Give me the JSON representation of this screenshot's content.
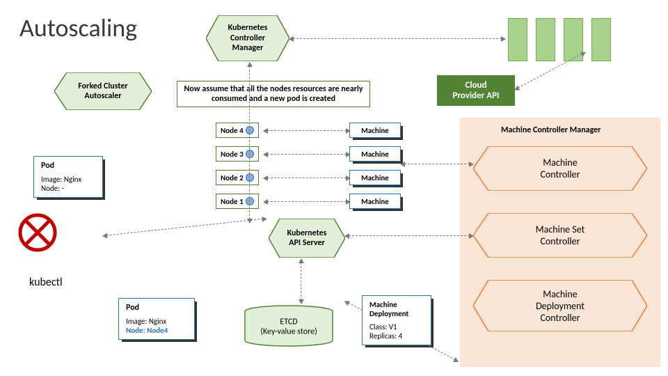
{
  "title": "Autoscaling",
  "k8s_controller_manager": "Kubernetes\nController\nManager",
  "forked_autoscaler": "Forked Cluster\nAutoscaler",
  "note": "Now assume that all the nodes resources are nearly consumed and a new pod is created",
  "nodes": [
    "Node 4",
    "Node 3",
    "Node 2",
    "Node 1"
  ],
  "machine_label": "Machine",
  "cloud_api": "Cloud\nProvider API",
  "mcm_label": "Machine Controller Manager",
  "controllers": [
    "Machine\nController",
    "Machine Set\nController",
    "Machine\nDeployment\nController"
  ],
  "api_server": "Kubernetes\nAPI Server",
  "etcd": "ETCD\n(Key-value store)",
  "kubectl": "kubectl",
  "pod1": {
    "title": "Pod",
    "image": "Image: Nginx",
    "node": "Node: -"
  },
  "pod2": {
    "title": "Pod",
    "image": "Image: Nginx",
    "node": "Node: Node4"
  },
  "deployment": {
    "title": "Machine\nDeployment",
    "class": "Class: V1",
    "replicas": "Replicas: 4"
  }
}
